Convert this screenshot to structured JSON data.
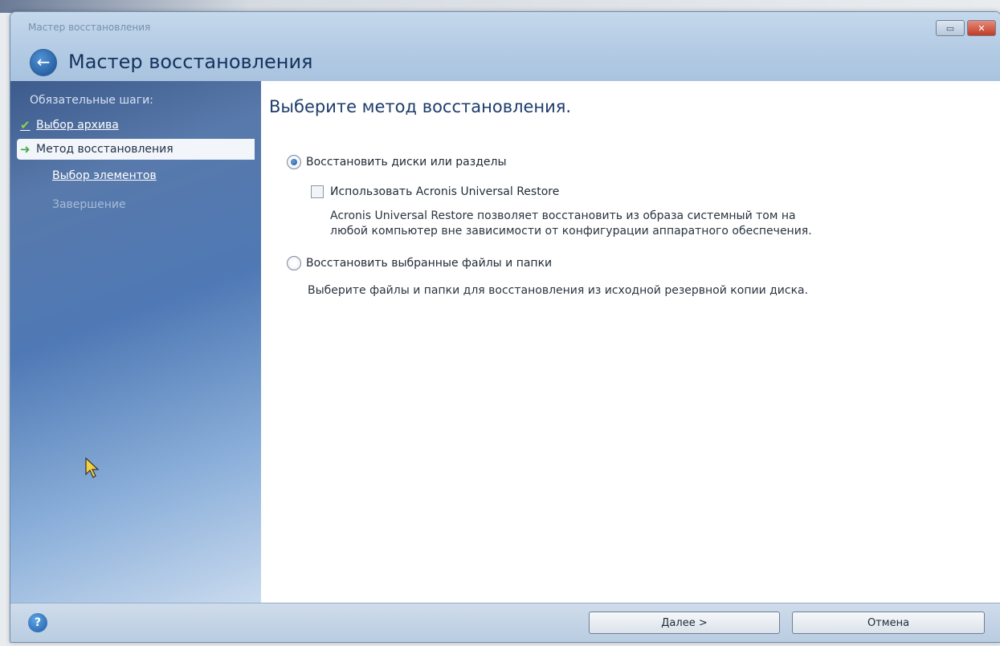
{
  "window": {
    "title": "Мастер восстановления",
    "wizard_title": "Мастер восстановления"
  },
  "sidebar": {
    "heading": "Обязательные шаги:",
    "steps": [
      {
        "label": "Выбор архива",
        "state": "done"
      },
      {
        "label": "Метод восстановления",
        "state": "current"
      },
      {
        "label": "Выбор элементов",
        "state": "link"
      },
      {
        "label": "Завершение",
        "state": "disabled"
      }
    ]
  },
  "content": {
    "heading": "Выберите метод восстановления.",
    "option_disks": {
      "label": "Восстановить диски или разделы",
      "checked": true
    },
    "universal_restore": {
      "label": "Использовать Acronis Universal Restore",
      "checked": false,
      "desc_line1": "Acronis Universal Restore позволяет восстановить из образа системный том на",
      "desc_line2": "любой компьютер вне зависимости от конфигурации аппаратного обеспечения."
    },
    "option_files": {
      "label": "Восстановить выбранные файлы и папки",
      "checked": false,
      "desc": "Выберите файлы и папки для восстановления из исходной резервной копии диска."
    }
  },
  "footer": {
    "next_label": "Далее >",
    "cancel_label": "Отмена"
  },
  "icons": {
    "back": "arrow-left-icon",
    "help": "help-icon",
    "done": "checkmark-icon",
    "current": "arrow-right-icon"
  }
}
